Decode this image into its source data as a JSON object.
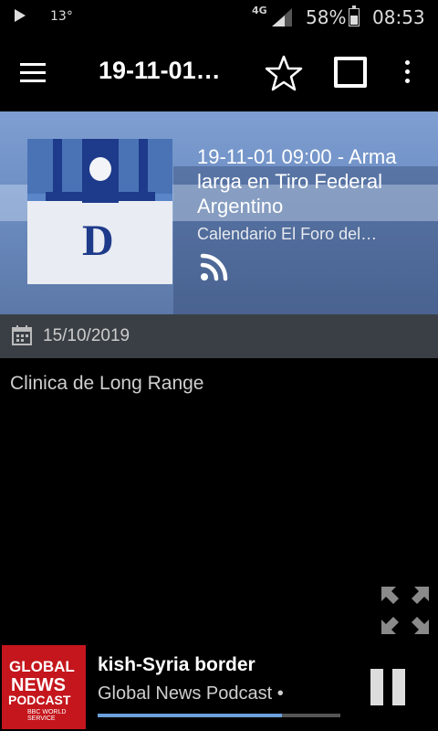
{
  "status_bar": {
    "temperature": "13°",
    "network_type": "4G",
    "battery_percent": "58%",
    "battery_level": 0.58,
    "time": "08:53"
  },
  "app_bar": {
    "title": "19-11-01…"
  },
  "episode": {
    "title": "19-11-01 09:00 - Arma larga en Tiro Federal Argentino",
    "podcast": "Calendario El Foro del…",
    "date": "15/10/2019",
    "description": "Clinica de Long Range",
    "artwork_letter": "D"
  },
  "player": {
    "thumb_line1": "GLOBAL",
    "thumb_line2": "NEWS",
    "thumb_line3": "PODCAST",
    "thumb_line4": "BBC WORLD SERVICE",
    "track_title": "kish-Syria border",
    "show_name": "Global News Podcast •",
    "progress": 0.76
  },
  "colors": {
    "hero_blue": "#6e8fc4",
    "date_bar": "#3a3f45",
    "progress_fill": "#6aa0dc",
    "bbc_red": "#c4161c"
  },
  "icons": [
    "play-icon",
    "signal-icon",
    "battery-icon",
    "menu-icon",
    "star-icon",
    "square-icon",
    "more-icon",
    "rss-icon",
    "calendar-icon",
    "fullscreen-icon",
    "pause-icon"
  ]
}
